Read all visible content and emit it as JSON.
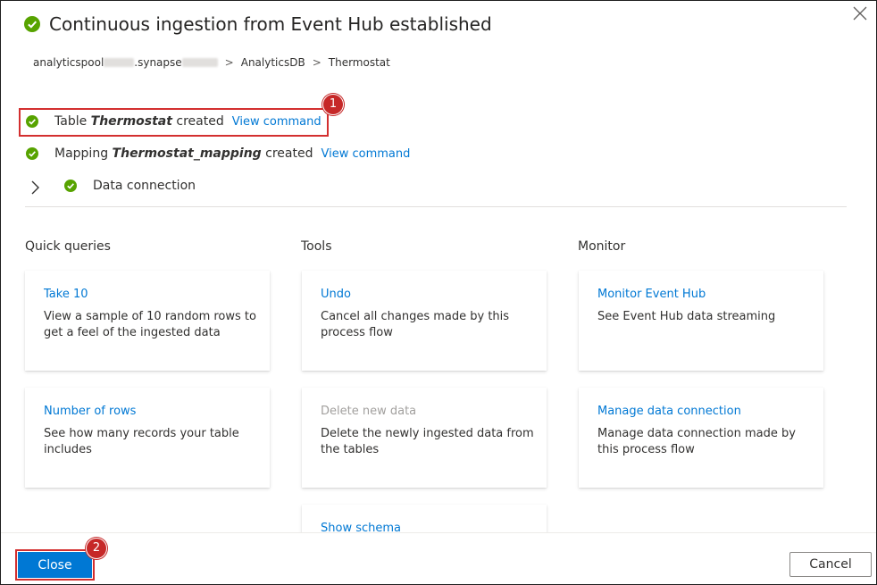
{
  "dialog": {
    "title": "Continuous ingestion from Event Hub established",
    "colors": {
      "accent": "#0078d4",
      "success": "#57a300",
      "highlight": "#d32f2f",
      "badge": "#c62828"
    }
  },
  "breadcrumb": {
    "workspace_prefix": "analyticspool",
    "workspace_middle": ".synapse",
    "database": "AnalyticsDB",
    "table": "Thermostat",
    "separator": ">"
  },
  "status": {
    "table": {
      "prefix": "Table",
      "name": "Thermostat",
      "suffix": "created",
      "link": "View command"
    },
    "mapping": {
      "prefix": "Mapping",
      "name": "Thermostat_mapping",
      "suffix": "created",
      "link": "View command"
    },
    "connection": {
      "label": "Data connection"
    }
  },
  "sections": {
    "quick_queries": "Quick queries",
    "tools": "Tools",
    "monitor": "Monitor"
  },
  "cards": {
    "take10": {
      "title": "Take 10",
      "desc": "View a sample of 10 random rows to get a feel of the ingested data"
    },
    "rows": {
      "title": "Number of rows",
      "desc": "See how many records your table includes"
    },
    "undo": {
      "title": "Undo",
      "desc": "Cancel all changes made by this process flow"
    },
    "delete": {
      "title": "Delete new data",
      "desc": "Delete the newly ingested data from the tables"
    },
    "schema": {
      "title": "Show schema"
    },
    "monitor_hub": {
      "title": "Monitor Event Hub",
      "desc": "See Event Hub data streaming"
    },
    "manage": {
      "title": "Manage data connection",
      "desc": "Manage data connection made by this process flow"
    }
  },
  "callouts": {
    "one": "1",
    "two": "2"
  },
  "footer": {
    "close": "Close",
    "cancel": "Cancel"
  }
}
